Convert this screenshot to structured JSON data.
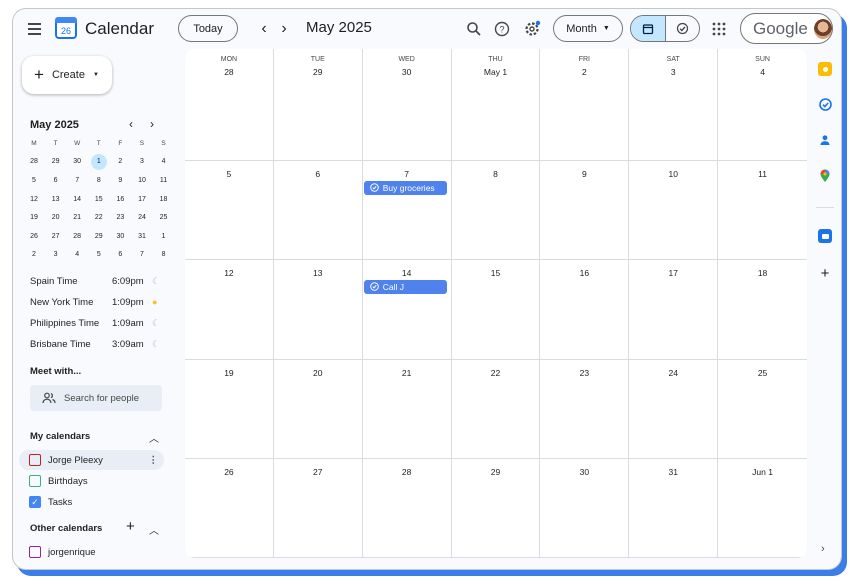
{
  "app": {
    "title": "Calendar",
    "logo_day": "26"
  },
  "header": {
    "today": "Today",
    "period": "May 2025",
    "view": "Month",
    "account": "Google"
  },
  "sidebar": {
    "create": "Create",
    "mini": {
      "title": "May 2025",
      "weekdays": [
        "M",
        "T",
        "W",
        "T",
        "F",
        "S",
        "S"
      ],
      "days": [
        "28",
        "29",
        "30",
        "1",
        "2",
        "3",
        "4",
        "5",
        "6",
        "7",
        "8",
        "9",
        "10",
        "11",
        "12",
        "13",
        "14",
        "15",
        "16",
        "17",
        "18",
        "19",
        "20",
        "21",
        "22",
        "23",
        "24",
        "25",
        "26",
        "27",
        "28",
        "29",
        "30",
        "31",
        "1",
        "2",
        "3",
        "4",
        "5",
        "6",
        "7",
        "8"
      ],
      "selected_index": 3
    },
    "timezones": [
      {
        "name": "Spain Time",
        "time": "6:09pm",
        "icon": "moon-icon"
      },
      {
        "name": "New York Time",
        "time": "1:09pm",
        "icon": "sun-icon"
      },
      {
        "name": "Philippines Time",
        "time": "1:09am",
        "icon": "moon-icon"
      },
      {
        "name": "Brisbane Time",
        "time": "3:09am",
        "icon": "moon-icon"
      }
    ],
    "meet": {
      "title": "Meet with...",
      "placeholder": "Search for people"
    },
    "my_calendars": {
      "title": "My calendars",
      "items": [
        {
          "name": "Jorge Pleexy",
          "color": "#c5221f",
          "checked": false
        },
        {
          "name": "Birthdays",
          "color": "#33b679",
          "checked": false
        },
        {
          "name": "Tasks",
          "color": "#4285f4",
          "checked": true
        }
      ]
    },
    "other_calendars": {
      "title": "Other calendars",
      "items": [
        {
          "name": "jorgenrique",
          "color": "#8e24aa",
          "checked": false
        }
      ]
    }
  },
  "grid": {
    "weekdays": [
      "MON",
      "TUE",
      "WED",
      "THU",
      "FRI",
      "SAT",
      "SUN"
    ],
    "dates": [
      "28",
      "29",
      "30",
      "May 1",
      "2",
      "3",
      "4",
      "5",
      "6",
      "7",
      "8",
      "9",
      "10",
      "11",
      "12",
      "13",
      "14",
      "15",
      "16",
      "17",
      "18",
      "19",
      "20",
      "21",
      "22",
      "23",
      "24",
      "25",
      "26",
      "27",
      "28",
      "29",
      "30",
      "31",
      "Jun 1"
    ],
    "events": [
      {
        "cell": 9,
        "title": "Buy groceries"
      },
      {
        "cell": 16,
        "title": "Call J"
      }
    ]
  }
}
